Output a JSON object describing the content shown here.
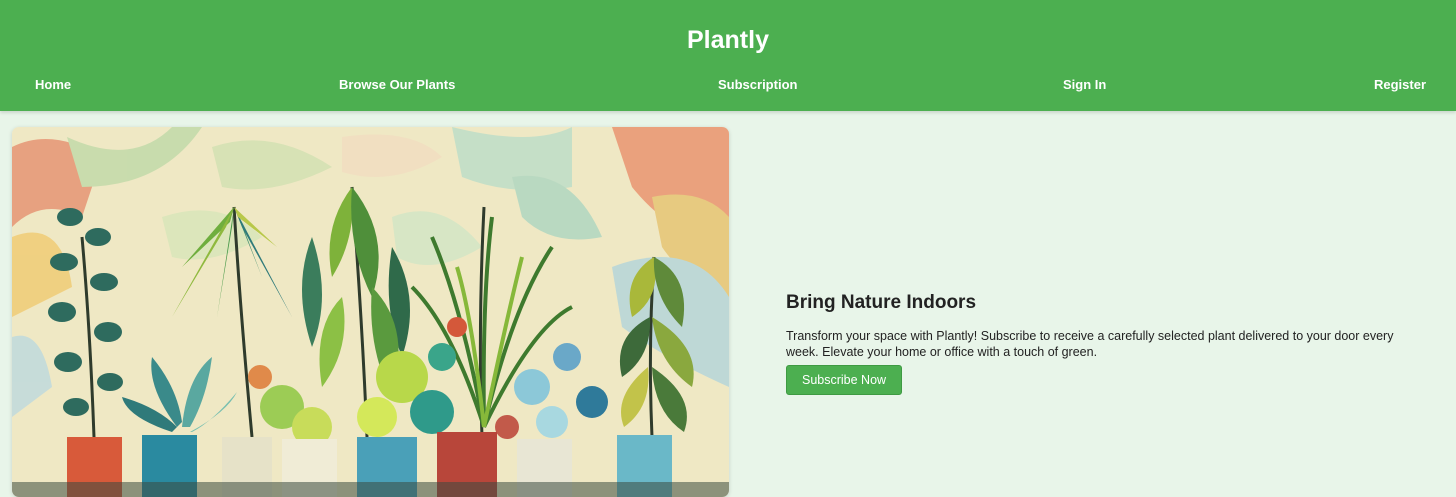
{
  "header": {
    "title": "Plantly",
    "background": "#4caf50",
    "nav": [
      {
        "label": "Home"
      },
      {
        "label": "Browse Our Plants"
      },
      {
        "label": "Subscription"
      },
      {
        "label": "Sign In"
      },
      {
        "label": "Register"
      }
    ]
  },
  "hero": {
    "image_subject": "painting of potted plants",
    "heading": "Bring Nature Indoors",
    "description": "Transform your space with Plantly! Subscribe to receive a carefully selected plant delivered to your door every week. Elevate your home or office with a touch of green.",
    "button_label": "Subscribe Now"
  },
  "colors": {
    "accent": "#4caf50",
    "page_background": "#e8f5e9",
    "text": "#222222"
  }
}
